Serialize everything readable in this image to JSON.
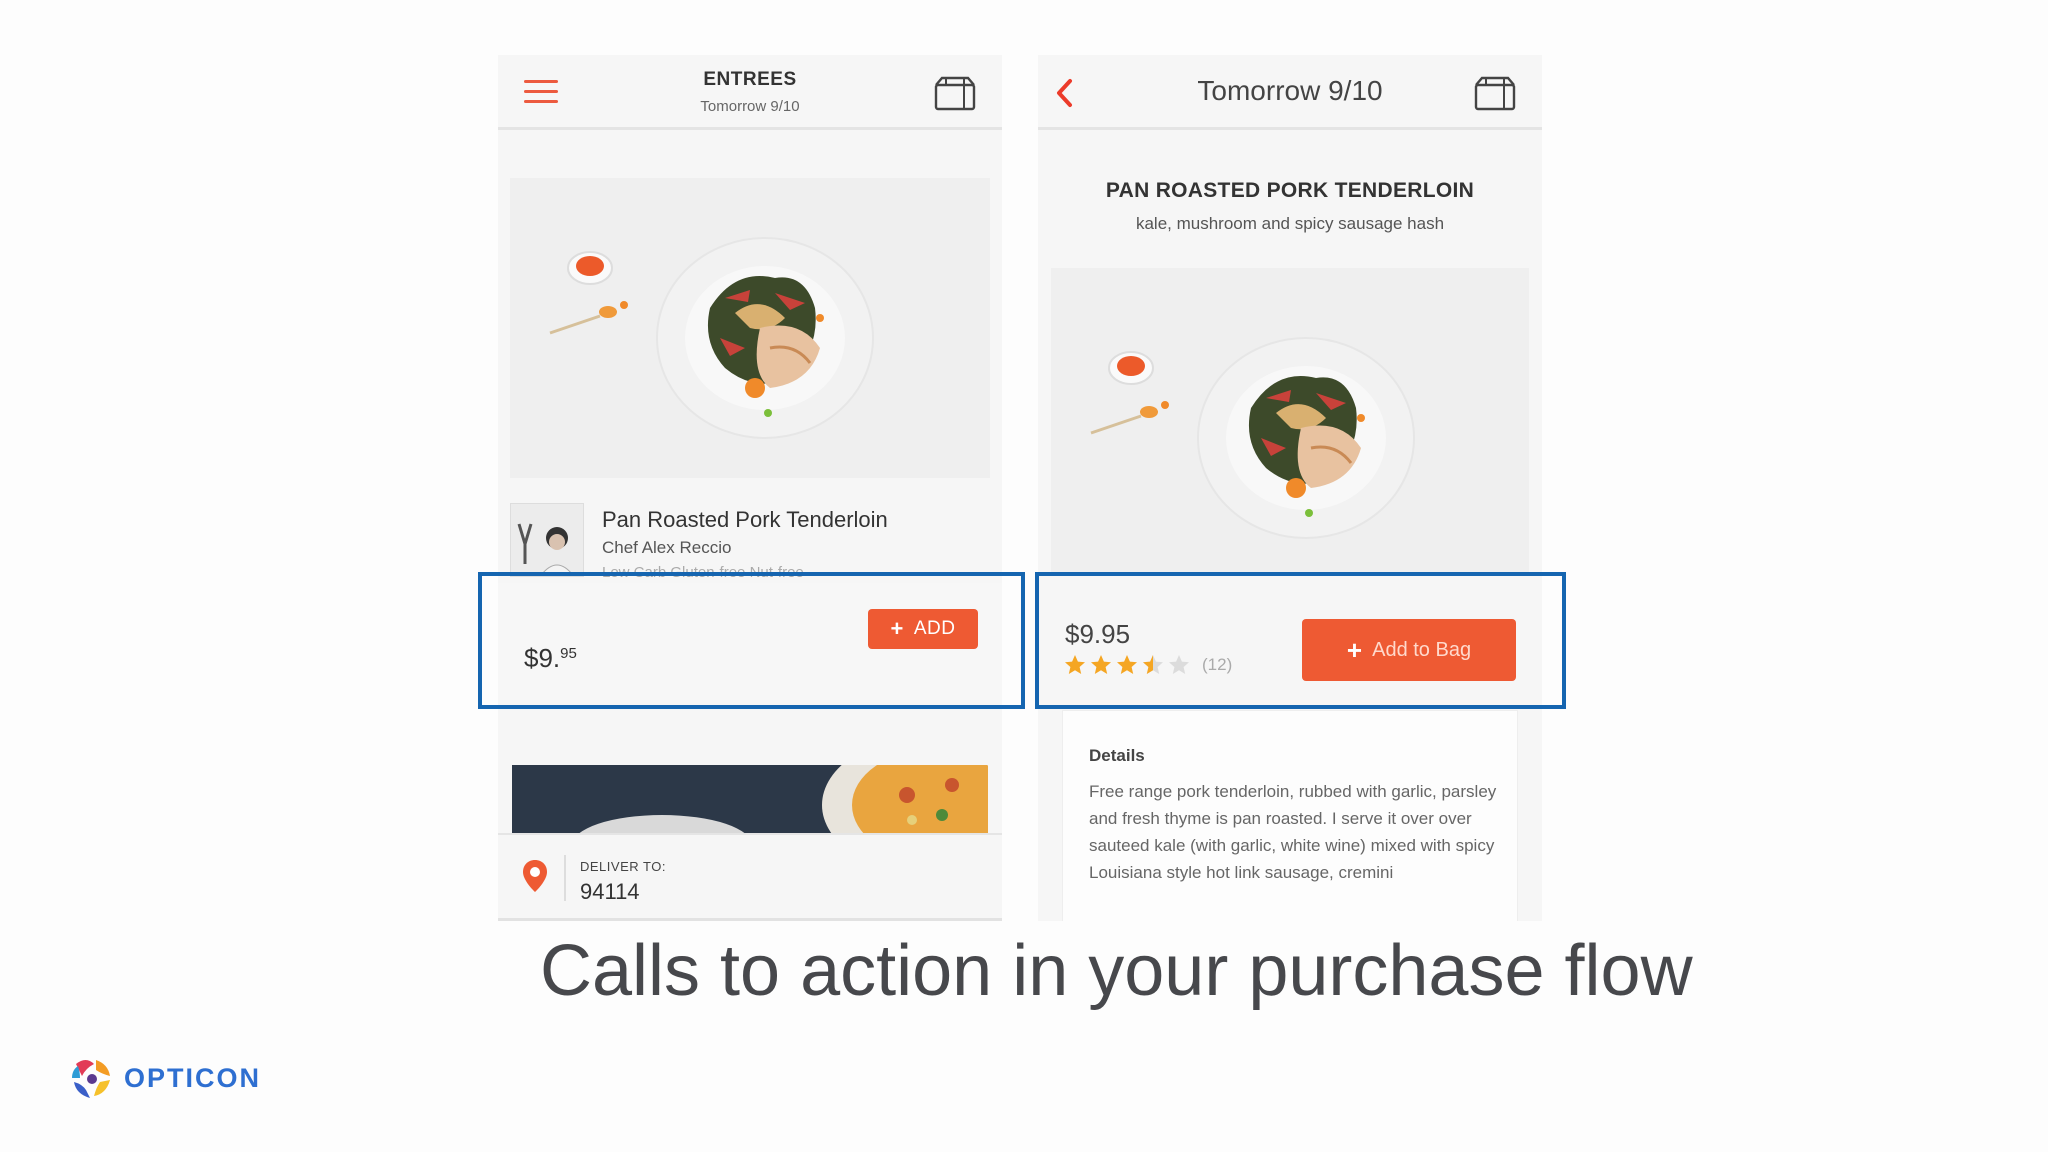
{
  "left_screen": {
    "title": "ENTREES",
    "subtitle": "Tomorrow 9/10",
    "product": {
      "name": "Pan Roasted Pork Tenderloin",
      "chef": "Chef Alex Reccio",
      "tags": "Low Carb    Gluten-free    Nut-free"
    },
    "price_dollars": "$9.",
    "price_cents": "95",
    "add_button_label": "ADD",
    "deliver": {
      "label": "DELIVER TO:",
      "zip": "94114"
    }
  },
  "right_screen": {
    "title": "Tomorrow 9/10",
    "dish_title": "PAN ROASTED PORK TENDERLOIN",
    "dish_subtitle": "kale, mushroom and spicy sausage hash",
    "price": "$9.95",
    "rating": 3.5,
    "rating_max": 5,
    "review_count": "(12)",
    "add_button_label": "Add to Bag",
    "details": {
      "heading": "Details",
      "body": "Free range pork tenderloin, rubbed with garlic, parsley and fresh thyme is pan roasted. I serve it over over sauteed kale (with garlic, white wine) mixed with spicy Louisiana style hot link sausage, cremini"
    }
  },
  "slide": {
    "headline": "Calls to action in your purchase flow",
    "logo_text": "OPTICON"
  },
  "colors": {
    "accent": "#ee5a33",
    "highlight": "#1565b0",
    "logo_blue": "#2e6fd1",
    "star": "#f5a623"
  },
  "icons": [
    "menu-icon",
    "shopping-bag-icon",
    "back-chevron-icon",
    "location-pin-icon",
    "star-icon",
    "plus-icon"
  ]
}
